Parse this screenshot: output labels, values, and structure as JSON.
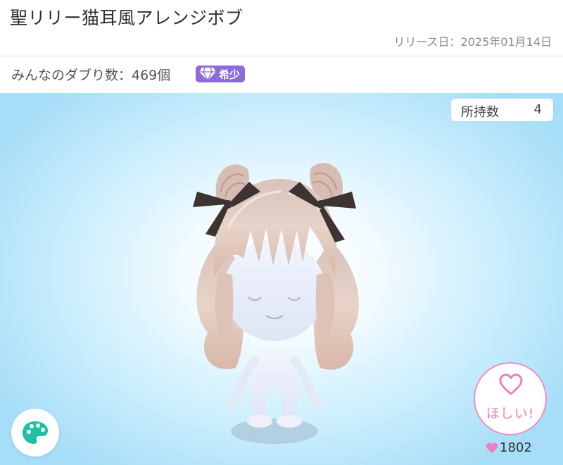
{
  "item": {
    "title": "聖リリー猫耳風アレンジボブ",
    "release_date": "リリース日：2025年01月14日"
  },
  "duplicates": {
    "label": "みんなのダブり数：469個",
    "rarity_badge": "希少"
  },
  "owned": {
    "label": "所持数",
    "value": "4"
  },
  "want_button": {
    "label": "ほしい!",
    "icon": "heart-outline-icon"
  },
  "likes": {
    "count": "1802",
    "icon": "heart-icon"
  },
  "palette_button": {
    "icon": "palette-icon"
  },
  "colors": {
    "accent_pink": "#ee7fbd",
    "rare_purple": "#8e6ae0",
    "palette_teal": "#1fc0a6",
    "stage_blue": "#a6ddf8"
  }
}
